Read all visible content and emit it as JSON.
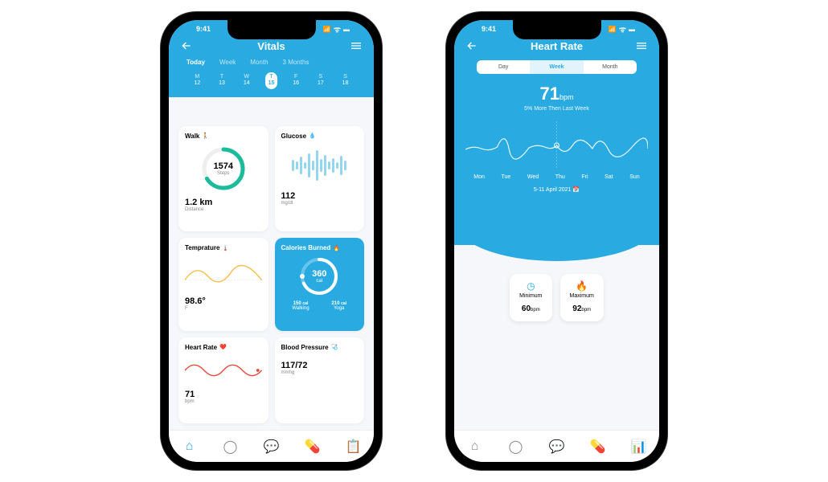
{
  "status": {
    "time": "9:41"
  },
  "vitals": {
    "title": "Vitals",
    "tabs": [
      "Today",
      "Week",
      "Month",
      "3 Months"
    ],
    "active_tab": 0,
    "days": [
      {
        "label": "M",
        "num": "12"
      },
      {
        "label": "T",
        "num": "13"
      },
      {
        "label": "W",
        "num": "14"
      },
      {
        "label": "T",
        "num": "15"
      },
      {
        "label": "F",
        "num": "16"
      },
      {
        "label": "S",
        "num": "17"
      },
      {
        "label": "S",
        "num": "18"
      }
    ],
    "active_day": 3,
    "walk": {
      "title": "Walk",
      "steps": "1574",
      "steps_label": "Steps",
      "distance": "1.2 km",
      "distance_label": "Distance"
    },
    "glucose": {
      "title": "Glucose",
      "value": "112",
      "unit": "mg/dl",
      "bars": [
        14,
        10,
        22,
        8,
        30,
        12,
        38,
        16,
        26,
        10,
        18,
        8,
        24,
        12
      ]
    },
    "temp": {
      "title": "Temprature",
      "value": "98.6°",
      "unit": "F"
    },
    "calories": {
      "title": "Calories Burned",
      "value": "360",
      "unit": "cal",
      "split": [
        {
          "val": "150",
          "unit": "cal",
          "label": "Walking"
        },
        {
          "val": "210",
          "unit": "cal",
          "label": "Yoga"
        }
      ]
    },
    "hr": {
      "title": "Heart Rate",
      "value": "71",
      "unit": "bpm"
    },
    "bp": {
      "title": "Blood Pressure",
      "value": "117/72",
      "unit": "mmhg"
    }
  },
  "heart_rate": {
    "title": "Heart Rate",
    "segments": [
      "Day",
      "Week",
      "Month"
    ],
    "active_segment": 1,
    "value": "71",
    "unit": "bpm",
    "subtitle": "5% More Then Last Week",
    "week_labels": [
      "Mon",
      "Tue",
      "Wed",
      "Thu",
      "Fri",
      "Sat",
      "Sun"
    ],
    "date_range": "5-11 April 2021",
    "min": {
      "label": "Minimum",
      "value": "60",
      "unit": "bpm"
    },
    "max": {
      "label": "Maximum",
      "value": "92",
      "unit": "bpm"
    }
  },
  "chart_data": [
    {
      "type": "bar",
      "title": "Glucose",
      "categories": [],
      "values": [
        14,
        10,
        22,
        8,
        30,
        12,
        38,
        16,
        26,
        10,
        18,
        8,
        24,
        12
      ]
    },
    {
      "type": "line",
      "title": "Heart Rate Week",
      "categories": [
        "Mon",
        "Tue",
        "Wed",
        "Thu",
        "Fri",
        "Sat",
        "Sun"
      ],
      "values": [
        68,
        70,
        82,
        71,
        66,
        78,
        72
      ],
      "ylim": [
        50,
        100
      ]
    }
  ]
}
